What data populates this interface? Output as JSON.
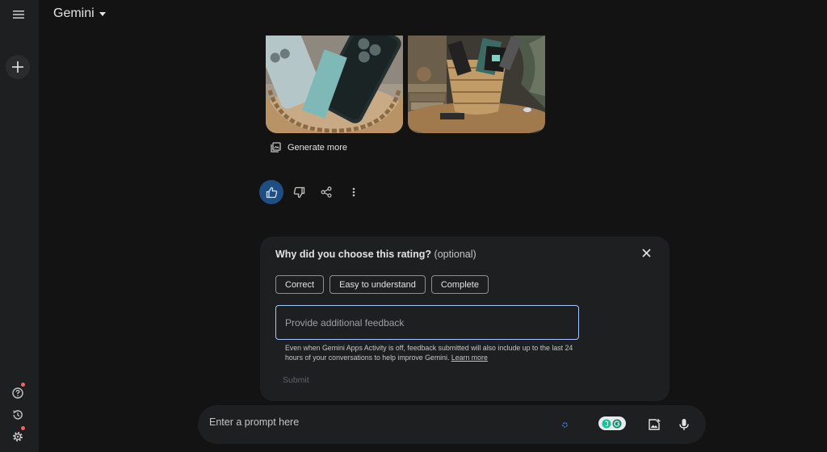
{
  "app": {
    "title": "Gemini"
  },
  "actions": {
    "generate_more": "Generate more"
  },
  "feedback": {
    "title": "Why did you choose this rating?",
    "optional": "(optional)",
    "chips": [
      "Correct",
      "Easy to understand",
      "Complete"
    ],
    "placeholder": "Provide additional feedback",
    "disclaimer": "Even when Gemini Apps Activity is off, feedback submitted will also include up to the last 24 hours of your conversations to help improve Gemini.",
    "learn_more": "Learn more",
    "submit": "Submit"
  },
  "prompt": {
    "placeholder": "Enter a prompt here"
  },
  "colors": {
    "background": "#131314",
    "surface": "#1e1f20",
    "accent": "#a8c7fa",
    "like_active": "#1f4e85",
    "notification": "#ee675c"
  }
}
